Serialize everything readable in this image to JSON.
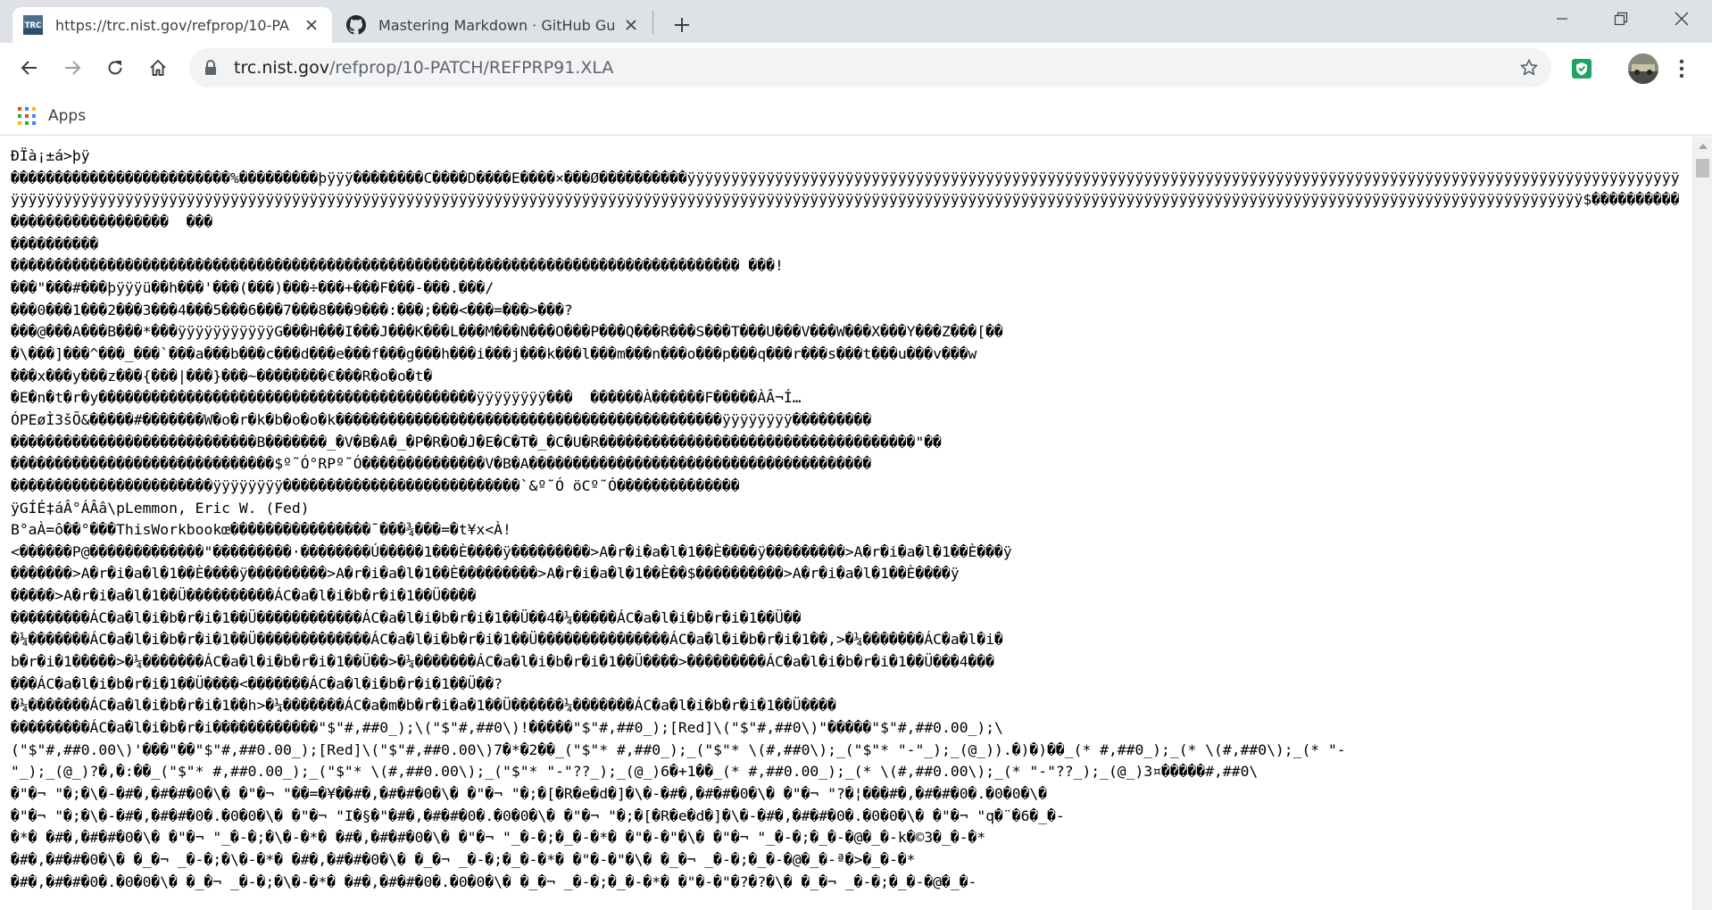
{
  "tabs": [
    {
      "title": "https://trc.nist.gov/refprop/10-PA",
      "active": true,
      "favicon_text": "TRC"
    },
    {
      "title": "Mastering Markdown · GitHub Gu",
      "active": false,
      "favicon": "github-icon"
    }
  ],
  "omnibox": {
    "url_host": "trc.nist.gov",
    "url_path": "/refprop/10-PATCH/REFPRP91.XLA"
  },
  "bookmarks": [
    {
      "label": "Apps"
    }
  ],
  "colors": {
    "tabstrip": "#dee1e6",
    "omnibox": "#f1f3f4",
    "extension": "#1ea362"
  },
  "page_text": "ÐÏà¡±á>þÿ\n�������������������������%���������þÿÿÿ��������C����D����E����×���Ø����������ÿÿÿÿÿÿÿÿÿÿÿÿÿÿÿÿÿÿÿÿÿÿÿÿÿÿÿÿÿÿÿÿÿÿÿÿÿÿÿÿÿÿÿÿÿÿÿÿÿÿÿÿÿÿÿÿÿÿÿÿÿÿÿÿÿÿÿÿÿÿÿÿÿÿÿÿÿÿÿÿÿÿÿÿÿÿÿÿÿÿÿÿÿÿÿÿÿÿÿÿÿÿÿÿÿÿÿÿÿÿÿÿÿÿÿÿÿÿÿÿÿÿÿÿÿÿÿÿÿÿÿÿÿÿÿÿÿÿÿÿÿÿÿÿÿÿÿÿÿÿÿÿÿÿÿÿÿÿÿÿÿÿÿÿÿÿÿÿÿÿÿÿÿÿÿÿÿÿÿÿÿÿÿÿÿÿÿÿÿÿÿÿÿÿÿÿÿÿÿÿÿÿÿÿÿÿÿÿÿÿÿÿÿÿÿÿÿÿÿÿÿÿÿÿÿÿÿÿÿÿÿÿÿÿÿÿÿÿÿÿÿÿÿÿÿÿÿÿÿÿÿÿÿÿÿÿÿÿÿÿÿÿÿÿÿÿÿÿÿÿÿÿÿÿÿÿÿÿÿÿÿÿÿÿÿÿÿÿÿÿÿÿ$����������������������������  ���\n����������\n����������������������������������������������������������������������������������� ���!\n���\"���#���þÿÿÿü��h���'���(���)���÷���+���F���-���.���/\n���0���1���2���3���4���5���6���7���8���9���:���;���<���=���>���?\n���@���A���B���*���ÿÿÿÿÿÿÿÿÿÿÿG���H���I���J���K���L���M���N���O���P���Q���R���S���T���U���V���W���X���Y���Z���[��\n�\\���]���^���_���`���a���b���c���d���e���f���g���h���i���j���k���l���m���n���o���p���q���r���s���t���u���v���w\n���x���y���z���{���|���}���~��������€���R�o�o�t�\n�E�n�t�r�y�������������������������������������������ÿÿÿÿÿÿÿÿ���  ������À������F�����ÀÂ¬Í…\nÓPEøÌ3šÕ&�����#�������W�o�r�k�b�o�o�k��������������������������������������������ÿÿÿÿÿÿÿÿ���������\n����������������������������B�������_�V�B�A�_�P�R�O�J�E�C�T�_�C�U�R������������������������������������\"��\n������������������������������$º˜Ó°RPº˜Ó��������������V�B�A���������������������������������������\n�����������������������ÿÿÿÿÿÿÿÿ���������������������������`&º˜Ó öCº˜Ó�������������� \nÿGÍÉ‡áÂ°ÁÂâ\\pLemmon, Eric W. (Fed)\nB°aÀ=ô��°���ThisWorkbookœ����������������¯���¾���=�t¥x<À!\n<������P@�������������\"���������·��������Ú�����1���È����ÿ���������>A�r�i�a�l�1��È����ÿ���������>A�r�i�a�l�1��È���ÿ\n�������>A�r�i�a�l�1��È����ÿ���������>A�r�i�a�l�1��È���������>A�r�i�a�l�1��È��$����������>A�r�i�a�l�1��È����ÿ\n�����>A�r�i�a�l�1��Ü����������ÁC�a�l�i�b�r�i�1��Ü����\n���������ÁC�a�l�i�b�r�i�1��Ü������������ÁC�a�l�i�b�r�i�1��Ü��4�¼�����ÁC�a�l�i�b�r�i�1��Ü��\n�¼�������ÁC�a�l�i�b�r�i�1��Ü�������������ÁC�a�l�i�b�r�i�1��Ü���������������ÁC�a�l�i�b�r�i�1��,>�¼�������ÁC�a�l�i�\nb�r�i�1�����>�¼�������ÁC�a�l�i�b�r�i�1��Ü��>�¼�������ÁC�a�l�i�b�r�i�1��Ü����>���������ÁC�a�l�i�b�r�i�1��Ü���4���\n���ÁC�a�l�i�b�r�i�1��Ü����<�������ÁC�a�l�i�b�r�i�1��Ü��?\n�¼�������ÁC�a�l�i�b�r�i�1��h>�¼�������ÁC�a�m�b�r�i�a�1��Ü������¼�������ÁC�a�l�i�b�r�i�1��Ü����\n���������ÁC�a�l�i�b�r�i������������\"$\"#,##0_);\\(\"$\"#,##0\\)!�����\"$\"#,##0_);[Red]\\(\"$\"#,##0\\)\"�����\"$\"#,##0.00_);\\\n(\"$\"#,##0.00\\)'���\"��\"$\"#,##0.00_);[Red]\\(\"$\"#,##0.00\\)7�*�2��_(\"$\"* #,##0_);_(\"$\"* \\(#,##0\\);_(\"$\"* \"-\"_);_(@_)).�)�)��_(* #,##0_);_(* \\(#,##0\\);_(* \"-\n\"_);_(@_)?�,�:��_(\"$\"* #,##0.00_);_(\"$\"* \\(#,##0.00\\);_(\"$\"* \"-\"??_);_(@_)6�+1��_(* #,##0.00_);_(* \\(#,##0.00\\);_(* \"-\"??_);_(@_)3¤�����#,##0\\\n�\"�¬ \"�;�\\�-�#�,�#�#�0�\\� �\"�¬ \"��=�¥��#�,�#�#�0�\\� �\"�¬ \"�;�[�R�e�d�]�\\�-�#�,�#�#�0�\\� �\"�¬ \"?�¦���#�,�#�#�0�.�0�0�\\�\n�\"�¬ \"�;�\\�-�#�,�#�#�0�.�0�0�\\� �\"�¬ \"I�§�\"�#�,�#�#�0�.�0�0�\\� �\"�¬ \"�;�[�R�e�d�]�\\�-�#�,�#�#�0�.�0�0�\\� �\"�¬ \"q�¨�6�_�-\n�*� �#�,�#�#�0�\\� �\"�¬ \"_�-�;�\\�-�*� �#�,�#�#�0�\\� �\"�¬ \"_�-�;�_�-�*� �\"�-�\"�\\� �\"�¬ \"_�-�;�_�-�@�_�-k�©3�_�-�*\n�#�,�#�#�0�\\� �_�¬ _�-�;�\\�-�*� �#�,�#�#�0�\\� �_�¬ _�-�;�_�-�*� �\"�-�\"�\\� �_�¬ _�-�;�_�-�@�_�-ª�>�_�-�*\n�#�,�#�#�0�.�0�0�\\� �_�¬ _�-�;�\\�-�*� �#�,�#�#�0�.�0�0�\\� �_�¬ _�-�;�_�-�*� �\"�-�\"�?�?�\\� �_�¬ _�-�;�_�-�@�_�-"
}
